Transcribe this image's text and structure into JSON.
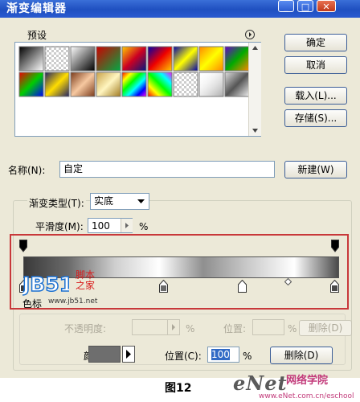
{
  "window": {
    "title": "渐变编辑器"
  },
  "titlebar_buttons": {
    "minimize": "_",
    "maximize": "□",
    "close": "✕"
  },
  "presets": {
    "label": "预设",
    "menu_icon": "circle-arrow-right-icon"
  },
  "buttons": {
    "ok": "确定",
    "cancel": "取消",
    "load": "载入(L)...",
    "save": "存储(S)...",
    "new": "新建(W)",
    "delete_opacity": "删除(D)",
    "delete_color": "删除(D)"
  },
  "name": {
    "label": "名称(N):",
    "value": "自定"
  },
  "gradient_type": {
    "label": "渐变类型(T):",
    "value": "实底"
  },
  "smoothness": {
    "label": "平滑度(M):",
    "value": "100",
    "unit": "%"
  },
  "stops_group": {
    "label": "色标"
  },
  "opacity_row": {
    "label": "不透明度:",
    "unit": "%",
    "location_label": "位置:",
    "location_unit": "%"
  },
  "color_row": {
    "label": "颜色:",
    "location_label": "位置(C):",
    "location_value": "100",
    "location_unit": "%",
    "swatch_color": "#6e6e6e"
  },
  "gradient_bar": {
    "colors": [
      "#3a3a3a",
      "#6a6a6a",
      "#cfcfcf",
      "#ffffff",
      "#8f8f8f",
      "#c9c9c9",
      "#ffffff",
      "#4a4a4a"
    ]
  },
  "caption": "图12",
  "watermarks": {
    "jb51_logo": "JB51",
    "jb51_cn1": "脚本",
    "jb51_cn2": "之家",
    "jb51_url": "www.jb51.net",
    "enet_logo": "eNet",
    "enet_cn": "网络学院",
    "enet_url": "www.eNet.com.cn/eschool"
  }
}
